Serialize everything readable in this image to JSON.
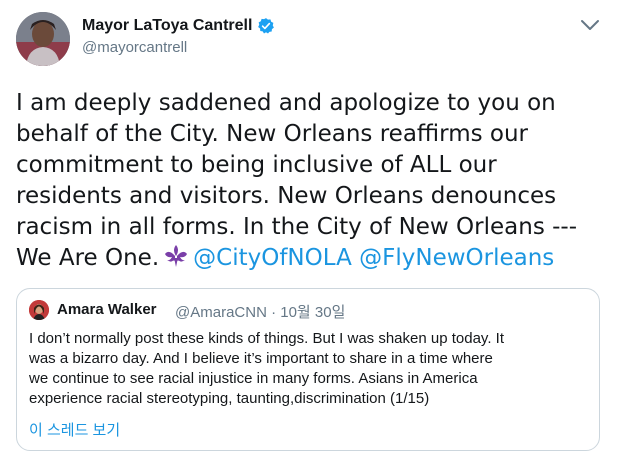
{
  "tweet": {
    "author_name": "Mayor LaToya Cantrell",
    "handle": "@mayorcantrell",
    "text_lines": [
      "I am deeply saddened and apologize to you on",
      "behalf of the City. New Orleans reaffirms our",
      "commitment to being inclusive of ALL our",
      "residents and visitors. New Orleans denounces",
      "racism in all forms. In the City of New Orleans ---"
    ],
    "last_line_text": "We Are One.",
    "mention_1": "@CityOfNOLA",
    "mention_2": "@FlyNewOrleans",
    "emoji_icon": "fleur-de-lis-icon",
    "verified_icon": "verified-badge-icon",
    "more_icon": "more-options-icon"
  },
  "quote": {
    "author_name": "Amara Walker",
    "meta": "@AmaraCNN · 10월 30일",
    "text_lines": [
      "I don’t normally post these kinds of things. But I was shaken up today.  It",
      "was a bizarro day. And I believe it’s important to share in a time where",
      "we continue to see racial injustice in many forms. Asians in America",
      "experience racial stereotyping, taunting,discrimination (1/15)"
    ],
    "thread_link": "이 스레드 보기"
  },
  "colors": {
    "link": "#1b95e0",
    "secondary_text": "#657786",
    "border": "#ccd6dd",
    "emoji": "#7a3fa8"
  }
}
